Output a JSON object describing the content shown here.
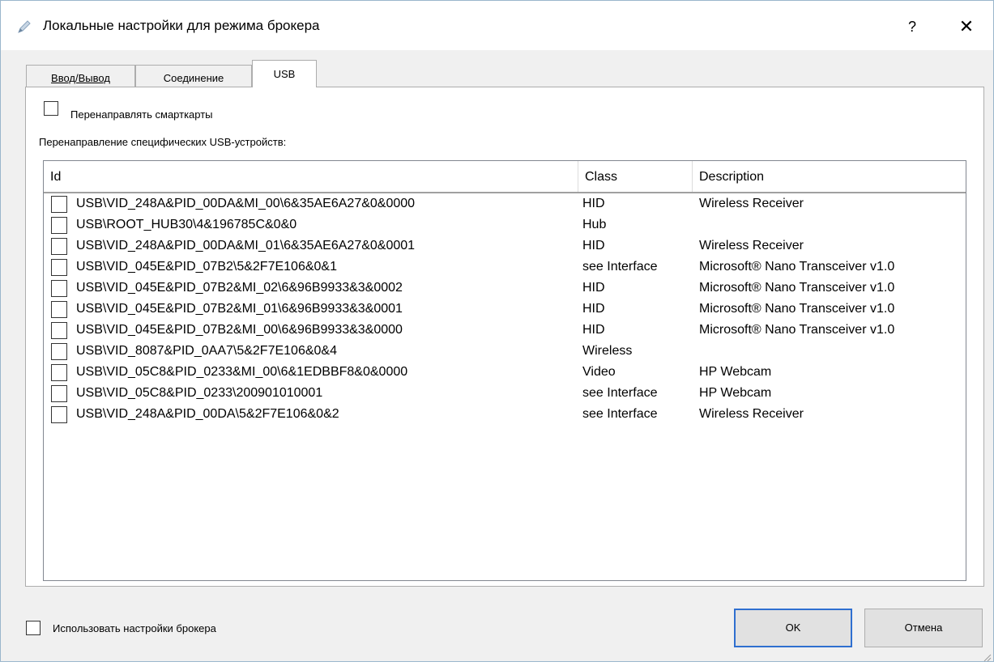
{
  "window": {
    "title": "Локальные настройки для режима брокера",
    "help_label": "?",
    "close_label": "✕"
  },
  "tabs": [
    {
      "label": "Ввод/Вывод",
      "active": false
    },
    {
      "label": "Соединение",
      "active": false
    },
    {
      "label": "USB",
      "active": true
    }
  ],
  "usb_tab": {
    "redirect_smartcards_label": "Перенаправлять смарткарты",
    "redirect_smartcards_checked": false,
    "specific_devices_label": "Перенаправление специфических USB-устройств:",
    "columns": {
      "id": "Id",
      "class": "Class",
      "description": "Description"
    },
    "devices": [
      {
        "id": "USB\\VID_248A&PID_00DA&MI_00\\6&35AE6A27&0&0000",
        "class": "HID",
        "description": "Wireless Receiver",
        "checked": false
      },
      {
        "id": "USB\\ROOT_HUB30\\4&196785C&0&0",
        "class": "Hub",
        "description": "",
        "checked": false
      },
      {
        "id": "USB\\VID_248A&PID_00DA&MI_01\\6&35AE6A27&0&0001",
        "class": "HID",
        "description": "Wireless Receiver",
        "checked": false
      },
      {
        "id": "USB\\VID_045E&PID_07B2\\5&2F7E106&0&1",
        "class": "see Interface",
        "description": "Microsoft® Nano Transceiver v1.0",
        "checked": false
      },
      {
        "id": "USB\\VID_045E&PID_07B2&MI_02\\6&96B9933&3&0002",
        "class": "HID",
        "description": "Microsoft® Nano Transceiver v1.0",
        "checked": false
      },
      {
        "id": "USB\\VID_045E&PID_07B2&MI_01\\6&96B9933&3&0001",
        "class": "HID",
        "description": "Microsoft® Nano Transceiver v1.0",
        "checked": false
      },
      {
        "id": "USB\\VID_045E&PID_07B2&MI_00\\6&96B9933&3&0000",
        "class": "HID",
        "description": "Microsoft® Nano Transceiver v1.0",
        "checked": false
      },
      {
        "id": "USB\\VID_8087&PID_0AA7\\5&2F7E106&0&4",
        "class": "Wireless",
        "description": "",
        "checked": false
      },
      {
        "id": "USB\\VID_05C8&PID_0233&MI_00\\6&1EDBBF8&0&0000",
        "class": "Video",
        "description": "HP Webcam",
        "checked": false
      },
      {
        "id": "USB\\VID_05C8&PID_0233\\200901010001",
        "class": "see Interface",
        "description": "HP Webcam",
        "checked": false
      },
      {
        "id": "USB\\VID_248A&PID_00DA\\5&2F7E106&0&2",
        "class": "see Interface",
        "description": "Wireless Receiver",
        "checked": false
      }
    ]
  },
  "footer": {
    "use_broker_settings_label": "Использовать настройки брокера",
    "use_broker_settings_checked": false,
    "ok_label": "OK",
    "cancel_label": "Отмена"
  },
  "colors": {
    "accent": "#2f6fd0",
    "dialog_background": "#f0f0f0",
    "panel_background": "#ffffff",
    "border": "#adadad"
  },
  "icons": {
    "title": "pen-icon",
    "close": "close-icon",
    "resize": "resize-grip-icon"
  }
}
